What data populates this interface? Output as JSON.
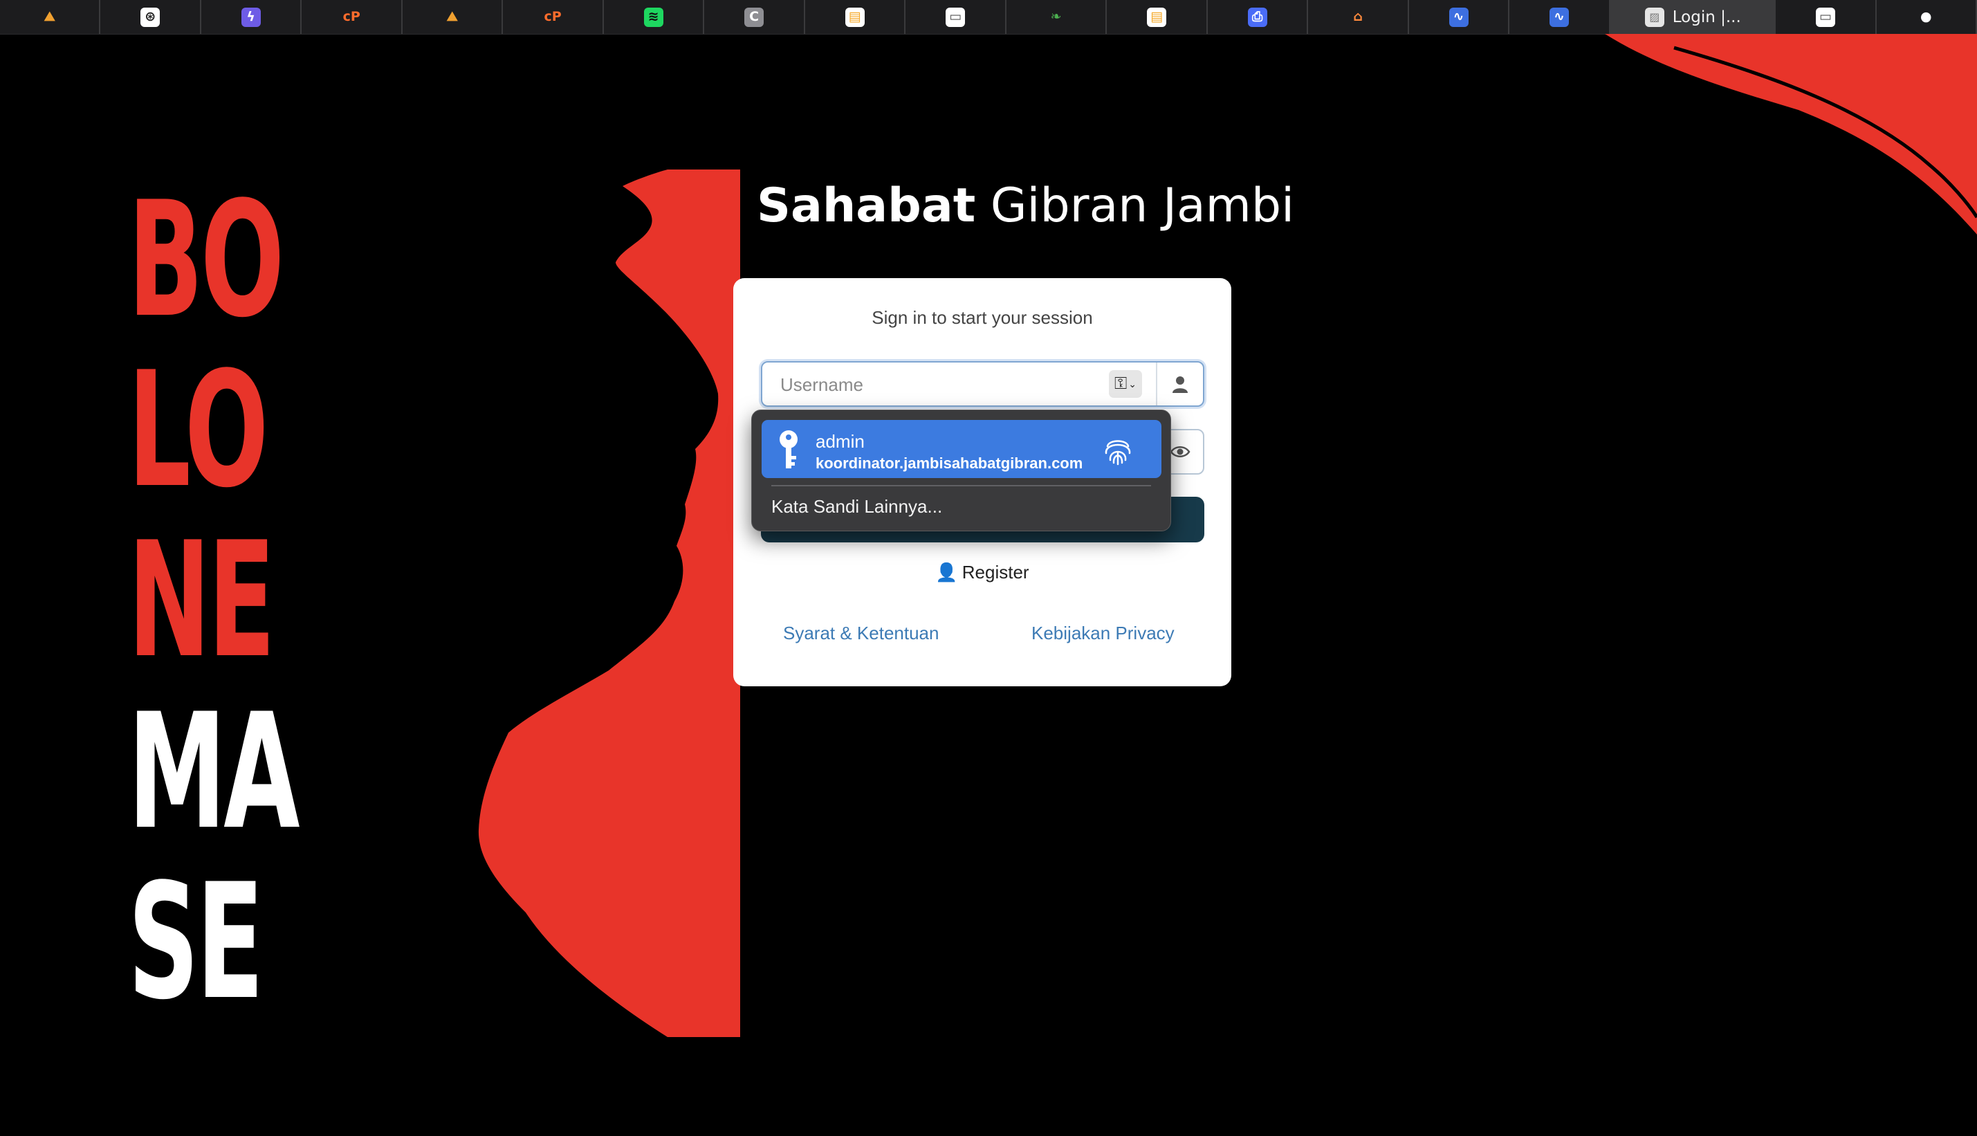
{
  "tabbar": {
    "tabs": [
      {
        "icon": "mountain-logo-icon",
        "glyph": "⛰",
        "fg": "#f0a030",
        "bg": "transparent"
      },
      {
        "icon": "openai-icon",
        "glyph": "⊛",
        "fg": "#222222",
        "bg": "#ffffff"
      },
      {
        "icon": "lightning-icon",
        "glyph": "ϟ",
        "fg": "#ffffff",
        "bg": "#6e5ce6"
      },
      {
        "icon": "cpanel-icon",
        "glyph": "cP",
        "fg": "#ff6c2c",
        "bg": "transparent"
      },
      {
        "icon": "mountain-logo-icon",
        "glyph": "⛰",
        "fg": "#f0a030",
        "bg": "transparent"
      },
      {
        "icon": "cpanel-icon",
        "glyph": "cP",
        "fg": "#ff6c2c",
        "bg": "transparent"
      },
      {
        "icon": "spotify-icon",
        "glyph": "≋",
        "fg": "#111111",
        "bg": "#1ed760"
      },
      {
        "icon": "c-letter-icon",
        "glyph": "C",
        "fg": "#ffffff",
        "bg": "#8e8e93"
      },
      {
        "icon": "document-icon",
        "glyph": "▤",
        "fg": "#f5a623",
        "bg": "#ffffff"
      },
      {
        "icon": "blank-page-icon",
        "glyph": "▭",
        "fg": "#555555",
        "bg": "#ffffff"
      },
      {
        "icon": "leaf-icon",
        "glyph": "❧",
        "fg": "#4caf50",
        "bg": "transparent"
      },
      {
        "icon": "document-icon",
        "glyph": "▤",
        "fg": "#f5a623",
        "bg": "#ffffff"
      },
      {
        "icon": "printer-icon",
        "glyph": "⎙",
        "fg": "#ffffff",
        "bg": "#4a6cf7"
      },
      {
        "icon": "store-icon",
        "glyph": "⌂",
        "fg": "#ff8a3d",
        "bg": "transparent"
      },
      {
        "icon": "wave-icon",
        "glyph": "∿",
        "fg": "#ffffff",
        "bg": "#3d6fe0"
      },
      {
        "icon": "wave-icon",
        "glyph": "∿",
        "fg": "#ffffff",
        "bg": "#3d6fe0"
      }
    ],
    "active_tab": {
      "title": "Login |...",
      "icon": "image-placeholder-icon"
    },
    "after_tabs": [
      {
        "icon": "blank-page-icon",
        "glyph": "▭",
        "fg": "#555555",
        "bg": "#ffffff"
      },
      {
        "icon": "github-icon",
        "glyph": "●",
        "fg": "#ffffff",
        "bg": "transparent"
      }
    ]
  },
  "art": {
    "slogan_red": [
      "BO",
      "LO",
      "NE"
    ],
    "slogan_white": [
      "MA",
      "SE"
    ],
    "accent_color": "#e8342a"
  },
  "brand": {
    "bold": "Sahabat",
    "light": "Gibran Jambi"
  },
  "login": {
    "message": "Sign in to start your session",
    "username_placeholder": "Username",
    "username_value": "",
    "register_label": "Register",
    "terms_link": "Syarat & Ketentuan",
    "privacy_link": "Kebijakan Privacy",
    "submit_color": "#173a4a"
  },
  "autofill": {
    "username": "admin",
    "site": "koordinator.jambisahabatgibran.com",
    "other_passwords": "Kata Sandi Lainnya...",
    "highlight_color": "#3c7be0"
  }
}
